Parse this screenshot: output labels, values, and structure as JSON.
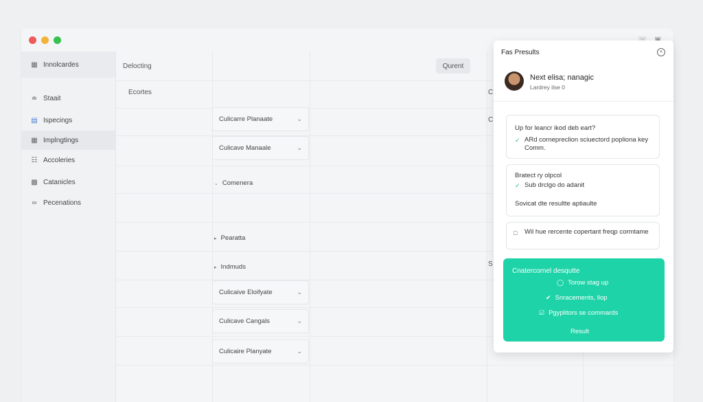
{
  "window": {
    "traffic_lights": [
      "#ef5a5a",
      "#f3b33a",
      "#35c24e"
    ],
    "toolbar_icons": [
      "phone-icon",
      "window-icon"
    ]
  },
  "sidebar": {
    "items": [
      {
        "label": "Innolcardes",
        "icon": "calendar-icon"
      },
      {
        "label": "Staait",
        "icon": "signal-icon"
      },
      {
        "label": "Ispecings",
        "icon": "chart-icon"
      },
      {
        "label": "Implngtings",
        "icon": "calendar-icon"
      },
      {
        "label": "Accoleries",
        "icon": "clipboard-icon"
      },
      {
        "label": "Catanicles",
        "icon": "image-icon"
      },
      {
        "label": "Pecenations",
        "icon": "link-icon"
      }
    ]
  },
  "main": {
    "header_title": "Delocting",
    "header_button": "Qurent",
    "section_title": "Ecortes",
    "dropdowns": [
      "Culicarre Planaate",
      "Culicave Manaale",
      "Culicaive Eloifyate",
      "Culicave Cangals",
      "Culicaire Planyate"
    ],
    "tree_items": [
      "Comenera",
      "Pearatta",
      "Indmuds"
    ],
    "edge_letters": [
      "C",
      "C",
      "S"
    ]
  },
  "panel": {
    "title": "Fas Presults",
    "profile_name": "Next elisa; nanagic",
    "profile_sub": "Lardrey ilse 0",
    "card1": {
      "title": "Up for leancr ikod deb eart?",
      "item": "ARd cornepreclion sciuectord popliona key Comm."
    },
    "card2": {
      "title": "Bratect ry olpcol",
      "item": "Sub drclgo do adanit",
      "footer": "Sovicat dte resultte aptiaulte"
    },
    "card3": {
      "text": "Wil hue rercente copertant freqp cormtame"
    },
    "highlight": {
      "title": "Cnatercornel desqutte",
      "items": [
        {
          "icon": "clock-icon",
          "label": "Torow stag up"
        },
        {
          "icon": "check-icon",
          "label": "Snracements, llop"
        },
        {
          "icon": "checkbox-icon",
          "label": "Pgyplitors se commards"
        }
      ],
      "button": "Result",
      "color": "#1ed3a8"
    }
  }
}
